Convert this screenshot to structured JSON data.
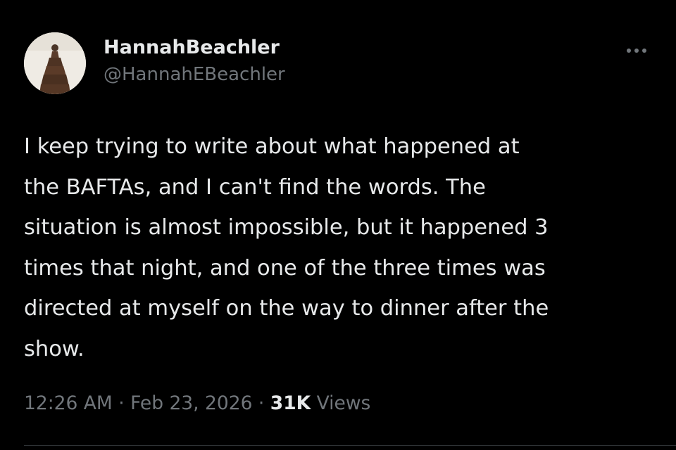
{
  "author": {
    "display_name": "HannahBeachler",
    "handle": "@HannahEBeachler",
    "avatar_icon": "profile-photo-icon"
  },
  "tweet": {
    "text": "I keep trying to write about what happened at\nthe BAFTAs, and I can't find the words.  The\nsituation is almost impossible, but it happened 3\ntimes that night, and one of the three times was\ndirected at myself on the way to dinner after the\nshow."
  },
  "meta": {
    "time": "12:26 AM",
    "separator": "·",
    "date": "Feb 23, 2026",
    "views_count": "31K",
    "views_label": "Views"
  },
  "icons": {
    "more": "more-horizontal-icon"
  },
  "colors": {
    "background": "#000000",
    "primary_text": "#e7e9ea",
    "secondary_text": "#71767b",
    "divider": "#2f3336"
  }
}
